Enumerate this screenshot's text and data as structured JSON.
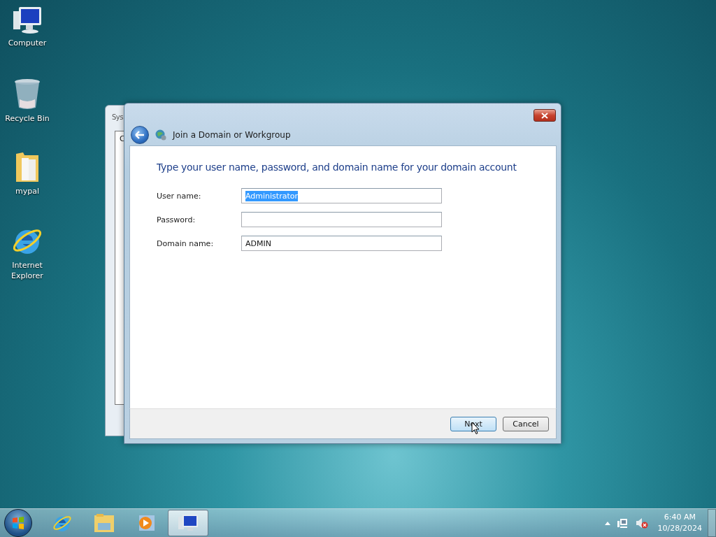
{
  "desktop_icons": [
    {
      "kind": "computer",
      "label": "Computer"
    },
    {
      "kind": "recycle",
      "label": "Recycle Bin"
    },
    {
      "kind": "folder",
      "label": "mypal"
    },
    {
      "kind": "ie",
      "label": "Internet Explorer"
    }
  ],
  "back_window": {
    "title": "Sys",
    "tab_label": "C"
  },
  "dialog": {
    "title": "Join a Domain or Workgroup",
    "heading": "Type your user name, password, and domain name for your domain account",
    "fields": [
      {
        "label": "User name:",
        "value": "Administrator",
        "text_selected": true
      },
      {
        "label": "Password:"
      },
      {
        "label": "Domain name:",
        "value": "ADMIN",
        "text_selected": false
      }
    ],
    "buttons": [
      {
        "label": "Next",
        "default": true
      },
      {
        "label": "Cancel",
        "default": false
      }
    ]
  },
  "taskbar": {
    "apps": [
      {
        "kind": "ie",
        "active": false
      },
      {
        "kind": "explorer",
        "active": false
      },
      {
        "kind": "media",
        "active": false
      },
      {
        "kind": "system",
        "active": true
      }
    ],
    "time": "6:40 AM",
    "date": "10/28/2024"
  }
}
